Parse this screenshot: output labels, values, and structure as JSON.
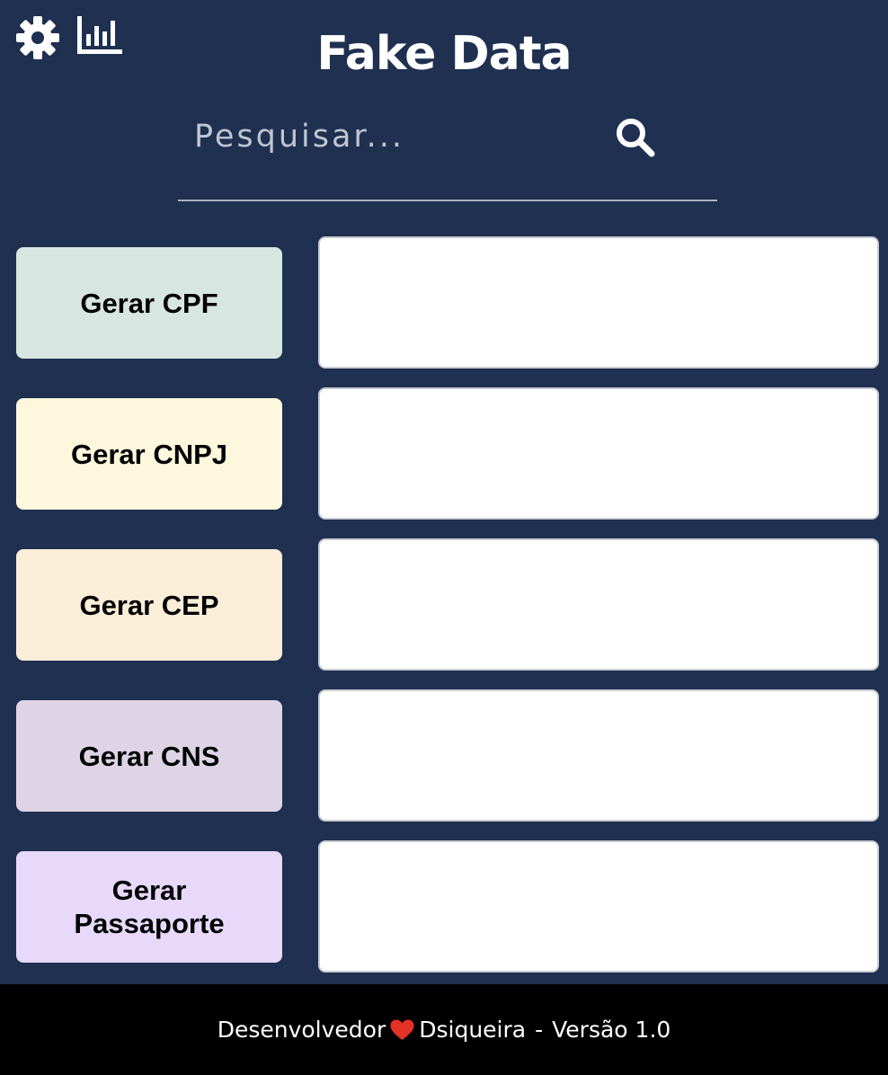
{
  "header": {
    "title": "Fake Data",
    "icons": [
      "gear-icon",
      "bar-chart-icon"
    ]
  },
  "search": {
    "placeholder": "Pesquisar...",
    "value": "",
    "icon": "search-icon"
  },
  "generators": [
    {
      "label": "Gerar CPF",
      "color": "#d7e6e0",
      "result": ""
    },
    {
      "label": "Gerar CNPJ",
      "color": "#fdf7dd",
      "result": ""
    },
    {
      "label": "Gerar CEP",
      "color": "#fbeed9",
      "result": ""
    },
    {
      "label": "Gerar CNS",
      "color": "#ded4e6",
      "result": ""
    },
    {
      "label": "Gerar Passaporte",
      "color": "#e8d9fb",
      "result": ""
    }
  ],
  "footer": {
    "developer_label": "Desenvolvedor",
    "heart_icon": "heart-icon",
    "heart_color": "#e53227",
    "author": "Dsiqueira",
    "separator": "-",
    "version": "Versão 1.0"
  },
  "colors": {
    "background": "#1f3050",
    "footer_background": "#000000"
  }
}
